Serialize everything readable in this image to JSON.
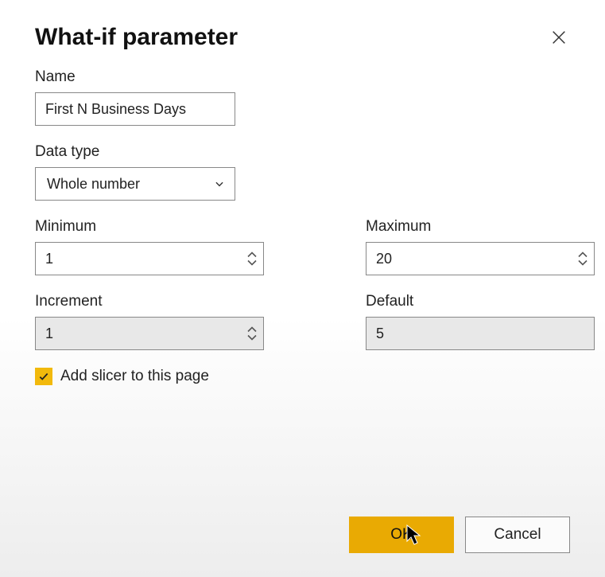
{
  "dialog": {
    "title": "What-if parameter",
    "name": {
      "label": "Name",
      "value": "First N Business Days"
    },
    "dataType": {
      "label": "Data type",
      "selected": "Whole number"
    },
    "minimum": {
      "label": "Minimum",
      "value": "1"
    },
    "maximum": {
      "label": "Maximum",
      "value": "20"
    },
    "increment": {
      "label": "Increment",
      "value": "1"
    },
    "default": {
      "label": "Default",
      "value": "5"
    },
    "addSlicer": {
      "label": "Add slicer to this page",
      "checked": true
    },
    "buttons": {
      "ok": "OK",
      "cancel": "Cancel"
    }
  }
}
